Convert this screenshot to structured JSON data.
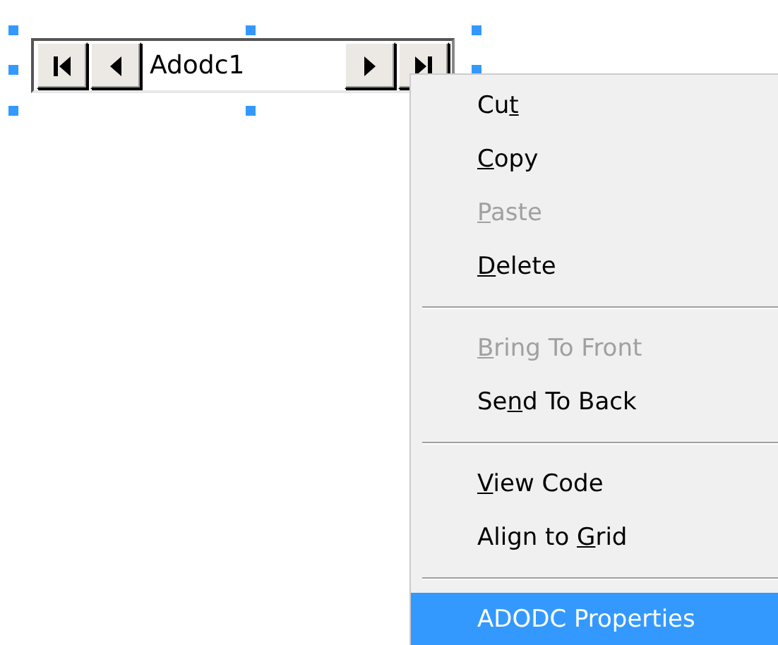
{
  "data_control": {
    "caption": "Adodc1"
  },
  "context_menu": [
    {
      "kind": "item",
      "pre": "Cu",
      "key": "t",
      "disabled": false,
      "selected": false
    },
    {
      "kind": "item",
      "key": "C",
      "post": "opy",
      "disabled": false,
      "selected": false
    },
    {
      "kind": "item",
      "key": "P",
      "post": "aste",
      "disabled": true,
      "selected": false
    },
    {
      "kind": "item",
      "key": "D",
      "post": "elete",
      "disabled": false,
      "selected": false
    },
    {
      "kind": "separator"
    },
    {
      "kind": "item",
      "key": "B",
      "post": "ring To Front",
      "disabled": true,
      "selected": false
    },
    {
      "kind": "item",
      "pre": "Se",
      "key": "n",
      "post": "d To Back",
      "disabled": false,
      "selected": false
    },
    {
      "kind": "separator"
    },
    {
      "kind": "item",
      "key": "V",
      "post": "iew Code",
      "disabled": false,
      "selected": false
    },
    {
      "kind": "item",
      "pre": "Align to ",
      "key": "G",
      "post": "rid",
      "disabled": false,
      "selected": false
    },
    {
      "kind": "separator"
    },
    {
      "kind": "item",
      "pre": "ADODC Properties",
      "disabled": false,
      "selected": true
    }
  ]
}
